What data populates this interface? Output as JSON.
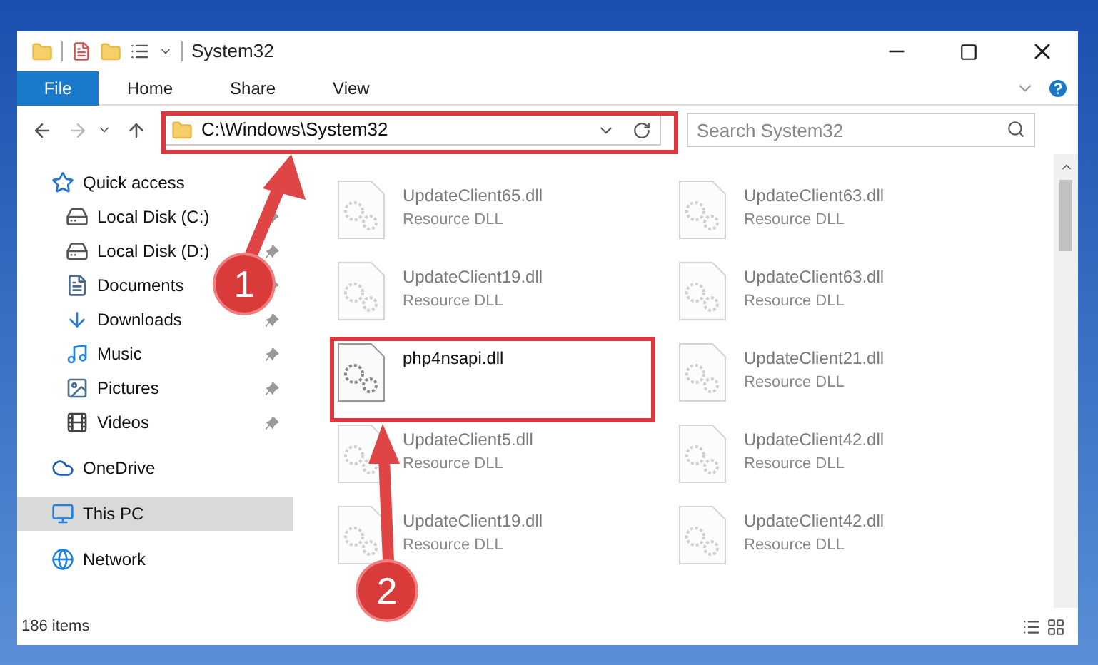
{
  "window": {
    "title": "System32"
  },
  "ribbon_tabs": [
    {
      "label": "File",
      "selected": true
    },
    {
      "label": "Home",
      "selected": false
    },
    {
      "label": "Share",
      "selected": false
    },
    {
      "label": "View",
      "selected": false
    }
  ],
  "address_bar": {
    "value": "C:\\Windows\\System32"
  },
  "search": {
    "placeholder": "Search System32"
  },
  "sidebar": {
    "items": [
      {
        "label": "Quick access",
        "kind": "star",
        "selected": false,
        "children": [
          {
            "label": "Local Disk (C:)",
            "kind": "disk",
            "pinned": true
          },
          {
            "label": "Local Disk (D:)",
            "kind": "disk",
            "pinned": true
          },
          {
            "label": "Documents",
            "kind": "doc",
            "pinned": true
          },
          {
            "label": "Downloads",
            "kind": "download",
            "pinned": true
          },
          {
            "label": "Music",
            "kind": "music",
            "pinned": true
          },
          {
            "label": "Pictures",
            "kind": "pictures",
            "pinned": true
          },
          {
            "label": "Videos",
            "kind": "videos",
            "pinned": true
          }
        ]
      },
      {
        "label": "OneDrive",
        "kind": "cloud",
        "selected": false
      },
      {
        "label": "This PC",
        "kind": "pc",
        "selected": true
      },
      {
        "label": "Network",
        "kind": "network",
        "selected": false
      }
    ]
  },
  "files": [
    {
      "name": "UpdateClient65.dll",
      "type": "Resource DLL",
      "faded": true
    },
    {
      "name": "UpdateClient63.dll",
      "type": "Resource DLL",
      "faded": true
    },
    {
      "name": "UpdateClient19.dll",
      "type": "Resource DLL",
      "faded": true
    },
    {
      "name": "UpdateClient63.dll",
      "type": "Resource DLL",
      "faded": true
    },
    {
      "name": "php4nsapi.dll",
      "faded": false,
      "highlighted": true
    },
    {
      "name": "UpdateClient21.dll",
      "type": "Resource DLL",
      "faded": true
    },
    {
      "name": "UpdateClient5.dll",
      "type": "Resource DLL",
      "faded": true
    },
    {
      "name": "UpdateClient42.dll",
      "type": "Resource DLL",
      "faded": true
    },
    {
      "name": "UpdateClient19.dll",
      "type": "Resource DLL",
      "faded": true
    },
    {
      "name": "UpdateClient42.dll",
      "type": "Resource DLL",
      "faded": true
    }
  ],
  "status_bar": {
    "count": "186 items"
  },
  "callouts": [
    {
      "number": "1"
    },
    {
      "number": "2"
    }
  ]
}
